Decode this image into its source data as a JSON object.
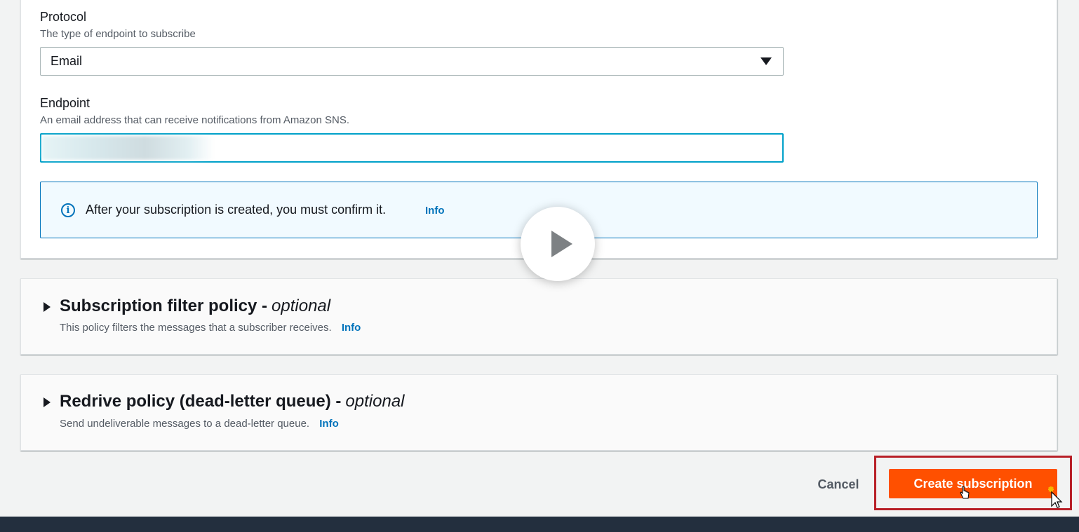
{
  "protocol": {
    "label": "Protocol",
    "description": "The type of endpoint to subscribe",
    "selected": "Email"
  },
  "endpoint": {
    "label": "Endpoint",
    "description": "An email address that can receive notifications from Amazon SNS.",
    "value": ""
  },
  "alert": {
    "text": "After your subscription is created, you must confirm it.",
    "info": "Info"
  },
  "filter_policy": {
    "title": "Subscription filter policy -",
    "optional": "optional",
    "description": "This policy filters the messages that a subscriber receives.",
    "info": "Info"
  },
  "redrive_policy": {
    "title": "Redrive policy (dead-letter queue) -",
    "optional": "optional",
    "description": "Send undeliverable messages to a dead-letter queue.",
    "info": "Info"
  },
  "actions": {
    "cancel": "Cancel",
    "create": "Create subscription"
  },
  "colors": {
    "primary_button": "#ff5000",
    "link": "#0073bb",
    "focus_border": "#00a1c9",
    "highlight_box": "#b81f27",
    "footer_bg": "#232f3e"
  },
  "icons": {
    "alert": "info-circle-icon",
    "select": "caret-down-icon",
    "expander": "caret-right-icon",
    "video": "play-icon"
  }
}
